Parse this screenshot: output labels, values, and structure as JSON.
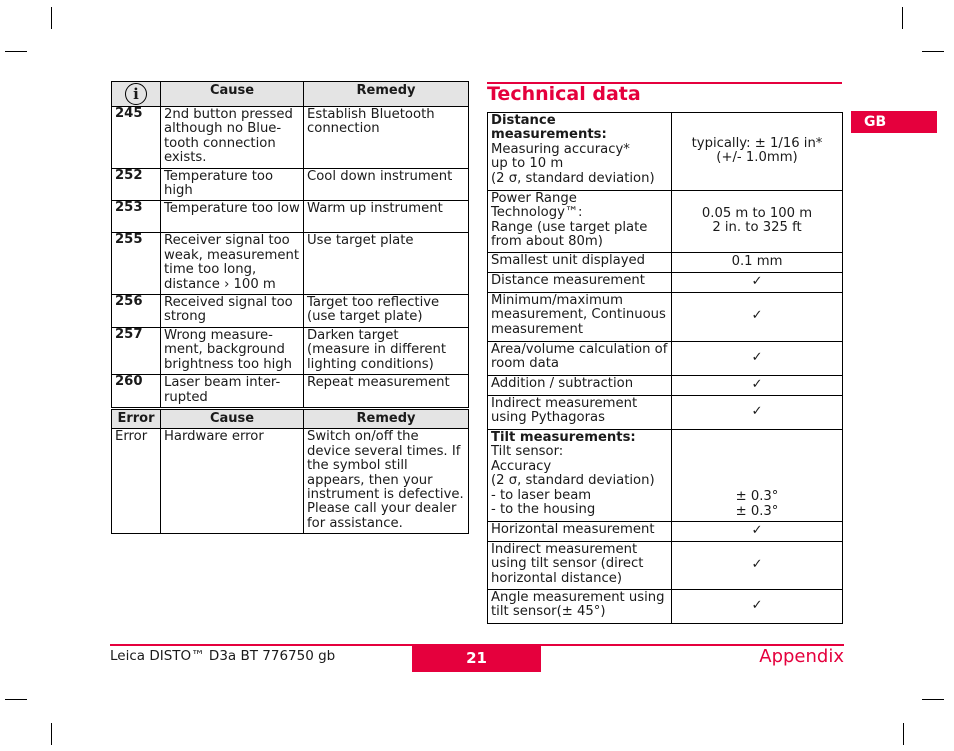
{
  "document": {
    "language_tab": "GB",
    "footer": {
      "product": "Leica DISTO™ D3a BT 776750 gb",
      "page_number": "21",
      "section": "Appendix"
    }
  },
  "error_table": {
    "icon": "info-icon",
    "headers": {
      "code": "i",
      "cause": "Cause",
      "remedy": "Remedy"
    },
    "rows": [
      {
        "code": "245",
        "cause": "2nd button pressed although no Blue-tooth connection exists.",
        "remedy": "Establish Bluetooth connection"
      },
      {
        "code": "252",
        "cause": "Temperature too high",
        "remedy": "Cool down instrument"
      },
      {
        "code": "253",
        "cause": "Temperature too low",
        "remedy": "Warm up instrument"
      },
      {
        "code": "255",
        "cause": "Receiver signal too weak, measurement time too long, distance › 100 m",
        "remedy": "Use target plate"
      },
      {
        "code": "256",
        "cause": "Received signal too strong",
        "remedy": "Target too reflective (use target plate)"
      },
      {
        "code": "257",
        "cause": "Wrong measure-ment, background brightness too high",
        "remedy": "Darken target (measure in different lighting conditions)"
      },
      {
        "code": "260",
        "cause": "Laser beam inter-rupted",
        "remedy": "Repeat measurement"
      }
    ]
  },
  "hardware_table": {
    "headers": {
      "error": "Error",
      "cause": "Cause",
      "remedy": "Remedy"
    },
    "rows": [
      {
        "error": "Error",
        "cause": "Hardware error",
        "remedy": "Switch on/off the device several times. If the symbol still appears, then your instrument is defective. Please call your dealer for assistance."
      }
    ]
  },
  "technical_data": {
    "title": "Technical data",
    "rows": [
      {
        "label_bold": "Distance measurements:",
        "label": "Measuring accuracy* up to 10 m (2 σ, standard deviation)",
        "value": "typically: ± 1/16 in* (+/- 1.0mm)"
      },
      {
        "label_bold": "",
        "label": "Power Range Technology™: Range (use target plate from about 80m)",
        "value": "0.05 m to 100 m 2 in. to 325 ft"
      },
      {
        "label_bold": "",
        "label": "Smallest unit displayed",
        "value": "0.1 mm"
      },
      {
        "label_bold": "",
        "label": "Distance measurement",
        "value": "✓"
      },
      {
        "label_bold": "",
        "label": "Minimum/maximum measurement, Continuous measurement",
        "value": "✓"
      },
      {
        "label_bold": "",
        "label": "Area/volume calculation of room data",
        "value": "✓"
      },
      {
        "label_bold": "",
        "label": "Addition / subtraction",
        "value": "✓"
      },
      {
        "label_bold": "",
        "label": "Indirect measurement using Pythagoras",
        "value": "✓"
      },
      {
        "label_bold": "Tilt measurements:",
        "label": "Tilt sensor: Accuracy (2 σ, standard deviation) - to laser beam - to the housing",
        "value": "± 0.3° ± 0.3°"
      },
      {
        "label_bold": "",
        "label": "Horizontal measurement",
        "value": "✓"
      },
      {
        "label_bold": "",
        "label": "Indirect measurement using tilt sensor (direct horizontal distance)",
        "value": "✓"
      },
      {
        "label_bold": "",
        "label": "Angle measurement using tilt sensor(± 45°)",
        "value": "✓"
      }
    ],
    "row_lines": {
      "r0_label": [
        "Measuring accuracy*",
        "up to 10 m",
        "(2 σ, standard deviation)"
      ],
      "r0_value": [
        "typically: ± 1/16 in*",
        "(+/- 1.0mm)"
      ],
      "r1_label": [
        "Power Range",
        "Technology™:",
        "Range (use target plate",
        "from about 80m)"
      ],
      "r1_value": [
        "0.05 m to 100 m",
        "2 in. to 325 ft"
      ],
      "r8_label": [
        "Tilt sensor:",
        "Accuracy",
        "(2 σ, standard deviation)",
        "- to laser beam",
        "- to the housing"
      ],
      "r8_value": [
        "± 0.3°",
        "± 0.3°"
      ]
    }
  }
}
